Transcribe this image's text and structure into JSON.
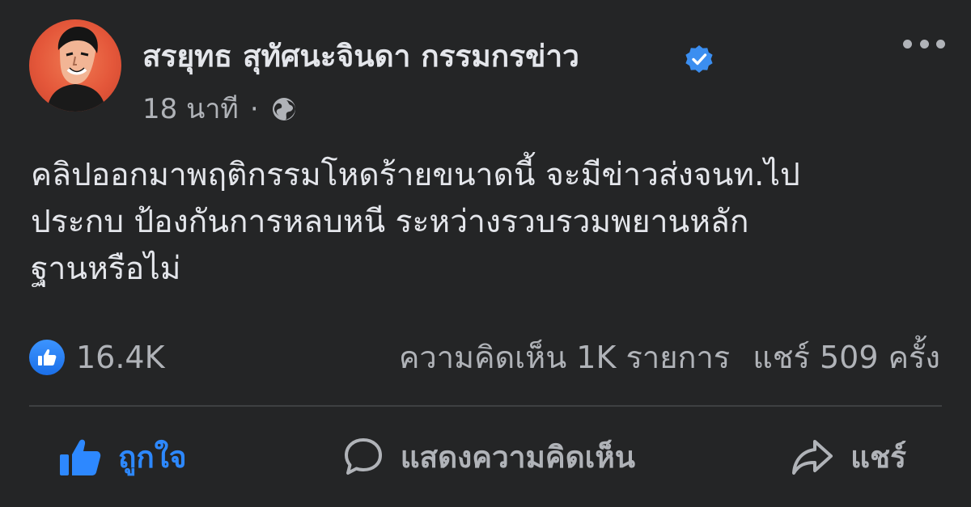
{
  "post": {
    "author": "สรยุทธ สุทัศนะจินดา กรรมกรข่าว",
    "verified": true,
    "time": "18 นาที",
    "separator": "·",
    "audience_icon": "globe-icon",
    "text_lines": [
      "คลิปออกมาพฤติกรรมโหดร้ายขนาดนี้ จะมีข่าวส่งจนท.ไป",
      "ประกบ ป้องกันการหลบหนี ระหว่างรวบรวมพยานหลัก",
      "ฐานหรือไม่"
    ]
  },
  "reactions": {
    "icon": "like-reaction-icon",
    "count": "16.4K"
  },
  "stats": {
    "comments": "ความคิดเห็น 1K รายการ",
    "shares": "แชร์ 509 ครั้ง"
  },
  "actions": {
    "like": "ถูกใจ",
    "comment": "แสดงความคิดเห็น",
    "share": "แชร์"
  },
  "colors": {
    "background": "#242526",
    "text": "#e4e6eb",
    "secondary": "#b0b3b8",
    "accent": "#2d88ff",
    "avatar_bg": "#e4573a"
  }
}
